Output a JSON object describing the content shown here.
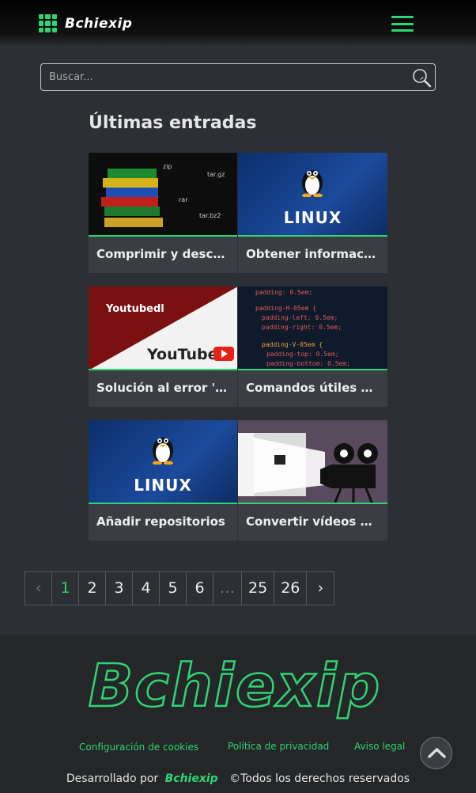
{
  "header": {
    "brand": "Bchiexip",
    "menu_icon": "hamburger-icon",
    "accent_color": "#2ed573"
  },
  "search": {
    "placeholder": "Buscar...",
    "value": "",
    "icon": "search-icon"
  },
  "main": {
    "section_title": "Últimas entradas",
    "posts": [
      {
        "title": "Comprimir y descomprimir archivos",
        "thumb_text": [
          "zip",
          "tar.gz",
          "rar",
          "tar.bz2"
        ]
      },
      {
        "title": "Obtener información del sistema",
        "thumb_text": [
          "LINUX"
        ]
      },
      {
        "title": "Solución al error 'unable to extract'",
        "thumb_text": [
          "Youtubedl",
          "YouTube"
        ]
      },
      {
        "title": "Comandos útiles de CSS",
        "thumb_text": [
          "padding: 0.5em;",
          "padding-H-05em {",
          "padding-left: 0.5em;",
          "padding-right: 0.5em;",
          "padding-V-05em {",
          "padding-top: 0.5em;",
          "padding-bottom: 0.5em;"
        ]
      },
      {
        "title": "Añadir repositorios",
        "thumb_text": [
          "LINUX"
        ]
      },
      {
        "title": "Convertir vídeos a GIF",
        "thumb_text": []
      }
    ]
  },
  "pagination": {
    "prev": "‹",
    "pages": [
      "1",
      "2",
      "3",
      "4",
      "5",
      "6",
      "…",
      "25",
      "26"
    ],
    "current": "1",
    "next": "›"
  },
  "footer": {
    "logo_text": "Bchiexip",
    "links": {
      "cookies": "Configuración de cookies",
      "privacy": "Política de privacidad",
      "legal": "Aviso legal"
    },
    "developed_by": "Desarrollado por",
    "brand": "Bchiexip",
    "rights": "©Todos los derechos reservados",
    "to_top_icon": "chevron-up-icon"
  }
}
